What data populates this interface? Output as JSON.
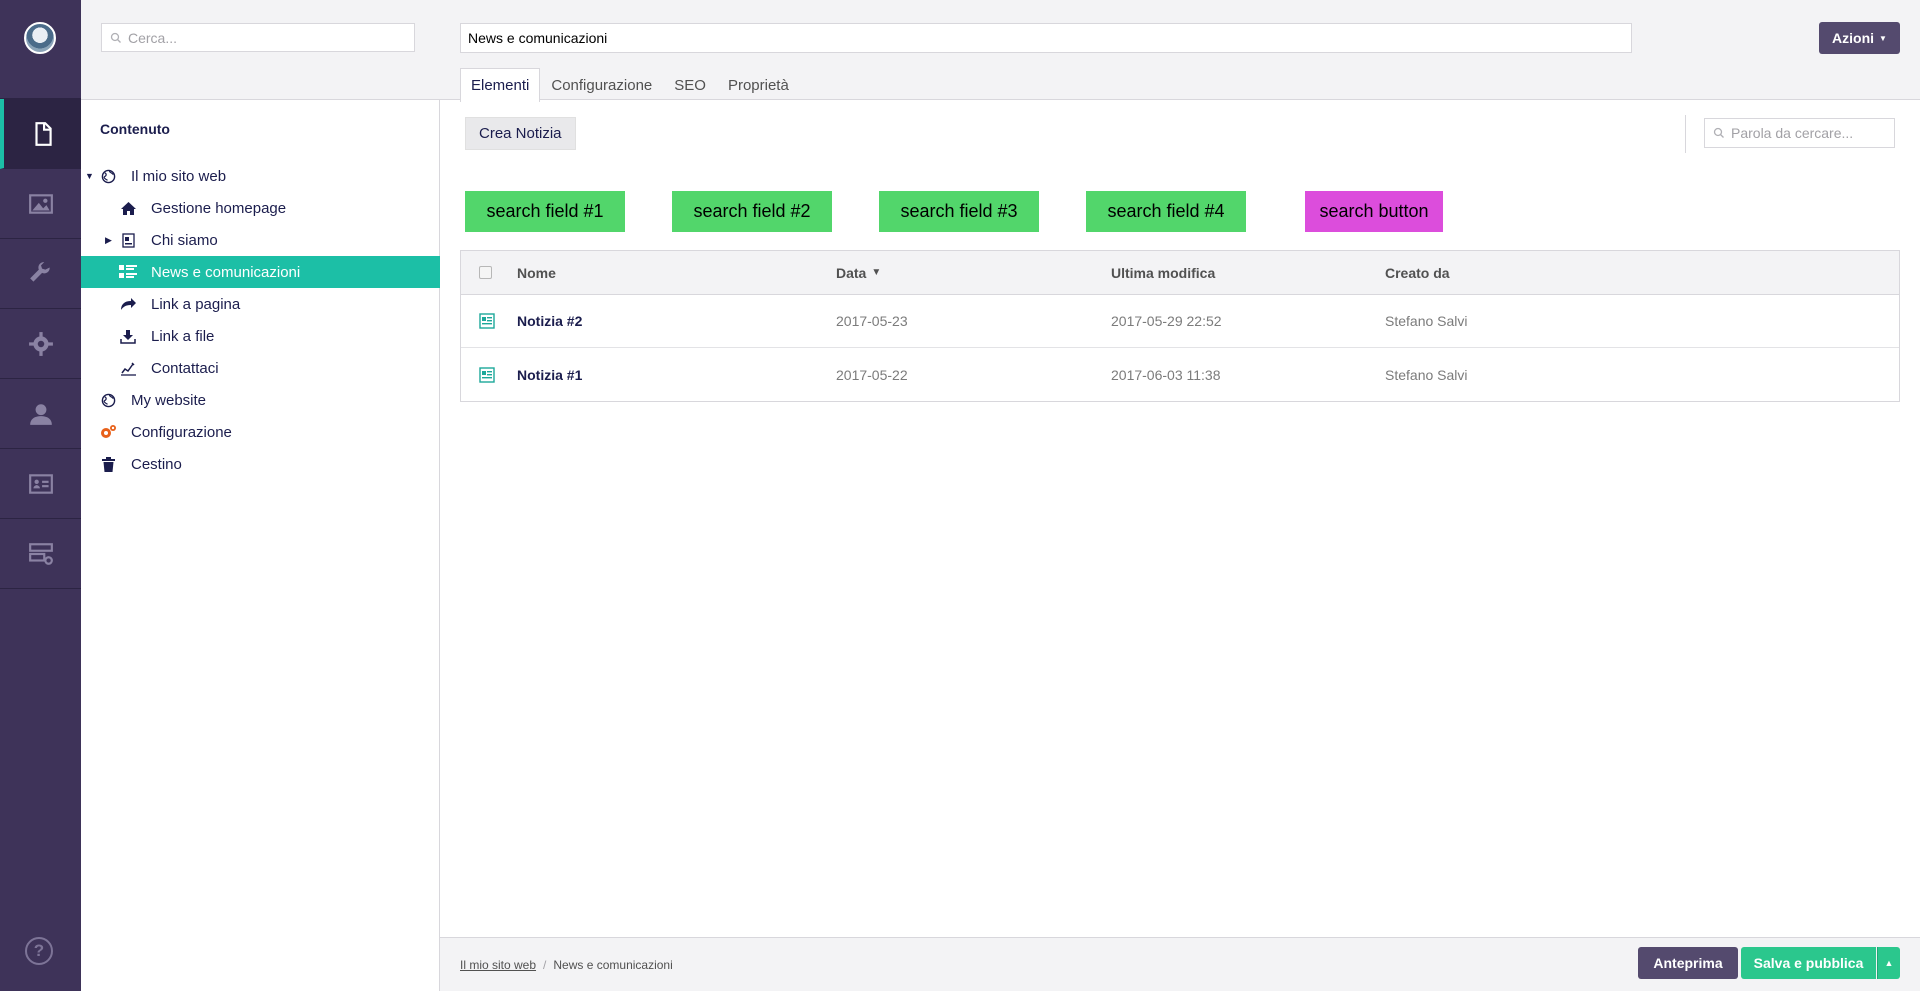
{
  "colors": {
    "rail_bg": "#3e3359",
    "accent_teal": "#1cbfa6",
    "primary_dark": "#544a6e",
    "publish_green": "#2bc78d",
    "search_field_green": "#52d66b",
    "search_button_magenta": "#dc4ddc"
  },
  "rail": {
    "icons": [
      "document-icon",
      "image-icon",
      "wrench-icon",
      "gear-icon",
      "user-icon",
      "id-card-icon",
      "server-add-icon"
    ],
    "help_label": "?"
  },
  "tree": {
    "search_placeholder": "Cerca...",
    "section_title": "Contenuto",
    "items": [
      {
        "label": "Il mio sito web",
        "icon": "globe-icon"
      },
      {
        "label": "Gestione homepage",
        "icon": "home-icon"
      },
      {
        "label": "Chi siamo",
        "icon": "page-icon"
      },
      {
        "label": "News e comunicazioni",
        "icon": "news-list-icon"
      },
      {
        "label": "Link a pagina",
        "icon": "link-page-icon"
      },
      {
        "label": "Link a file",
        "icon": "download-icon"
      },
      {
        "label": "Contattaci",
        "icon": "form-icon"
      },
      {
        "label": "My website",
        "icon": "globe-icon"
      },
      {
        "label": "Configurazione",
        "icon": "gears-icon"
      },
      {
        "label": "Cestino",
        "icon": "trash-icon"
      }
    ]
  },
  "header": {
    "title_value": "News e comunicazioni",
    "actions_label": "Azioni",
    "tabs": [
      "Elementi",
      "Configurazione",
      "SEO",
      "Proprietà"
    ]
  },
  "toolbar": {
    "create_label": "Crea Notizia",
    "search_placeholder": "Parola da cercare..."
  },
  "search_overlays": [
    "search field #1",
    "search field #2",
    "search field #3",
    "search field #4",
    "search button"
  ],
  "table": {
    "columns": [
      "Nome",
      "Data",
      "Ultima modifica",
      "Creato da"
    ],
    "rows": [
      {
        "name": "Notizia #2",
        "date": "2017-05-23",
        "modified": "2017-05-29 22:52",
        "author": "Stefano Salvi"
      },
      {
        "name": "Notizia #1",
        "date": "2017-05-22",
        "modified": "2017-06-03 11:38",
        "author": "Stefano Salvi"
      }
    ]
  },
  "footer": {
    "breadcrumb": [
      "Il mio sito web",
      "News e comunicazioni"
    ],
    "breadcrumb_separator": "/",
    "preview_label": "Anteprima",
    "publish_label": "Salva e pubblica"
  }
}
